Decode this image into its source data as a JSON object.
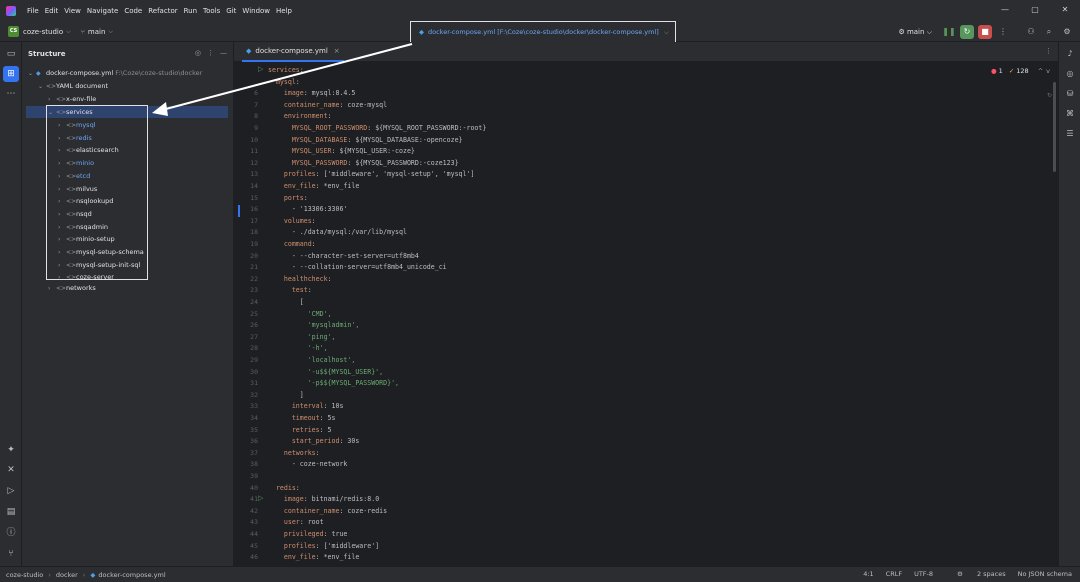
{
  "menu": [
    "File",
    "Edit",
    "View",
    "Navigate",
    "Code",
    "Refactor",
    "Run",
    "Tools",
    "Git",
    "Window",
    "Help"
  ],
  "window_controls": [
    "—",
    "▢",
    "✕"
  ],
  "toolbar": {
    "project_badge": "CS",
    "project_name": "coze-studio",
    "branch": "main",
    "run_config": "main",
    "chevron": "⌵"
  },
  "popup": {
    "file_name": "docker-compose.yml",
    "file_path": "[F:\\Coze\\coze-studio\\docker\\docker-compose.yml]",
    "chevron": "⌵"
  },
  "structure": {
    "title": "Structure",
    "root": {
      "label": "docker-compose.yml",
      "path": "F:\\Coze\\coze-studio\\docker"
    },
    "yaml_doc": "YAML document",
    "x_env": "x-env-file",
    "services": "services",
    "service_items": [
      "mysql",
      "redis",
      "elasticsearch",
      "minio",
      "etcd",
      "milvus",
      "nsqlookupd",
      "nsqd",
      "nsqadmin",
      "minio-setup",
      "mysql-setup-schema",
      "mysql-setup-init-sql",
      "coze-server"
    ],
    "networks": "networks"
  },
  "editor": {
    "tab_label": "docker-compose.yml",
    "tab_close": "×",
    "errors": "1",
    "warnings": "128",
    "lines": [
      {
        "n": "",
        "k": "services",
        "v": ":"
      },
      {
        "n": "",
        "k": "  mysql",
        "v": ":"
      },
      {
        "n": "6",
        "k": "    image",
        "v": ": mysql:8.4.5"
      },
      {
        "n": "7",
        "k": "    container_name",
        "v": ": coze-mysql"
      },
      {
        "n": "8",
        "k": "    environment",
        "v": ":"
      },
      {
        "n": "9",
        "k": "      MYSQL_ROOT_PASSWORD",
        "v": ": ${MYSQL_ROOT_PASSWORD:-root}"
      },
      {
        "n": "10",
        "k": "      MYSQL_DATABASE",
        "v": ": ${MYSQL_DATABASE:-opencoze}"
      },
      {
        "n": "11",
        "k": "      MYSQL_USER",
        "v": ": ${MYSQL_USER:-coze}"
      },
      {
        "n": "12",
        "k": "      MYSQL_PASSWORD",
        "v": ": ${MYSQL_PASSWORD:-coze123}"
      },
      {
        "n": "13",
        "k": "    profiles",
        "v": ": ['middleware', 'mysql-setup', 'mysql']"
      },
      {
        "n": "14",
        "k": "    env_file",
        "v": ": *env_file"
      },
      {
        "n": "15",
        "k": "    ports",
        "v": ":"
      },
      {
        "n": "16",
        "k": "",
        "v": "      - '13306:3306'"
      },
      {
        "n": "17",
        "k": "    volumes",
        "v": ":"
      },
      {
        "n": "18",
        "k": "",
        "v": "      - ./data/mysql:/var/lib/mysql"
      },
      {
        "n": "19",
        "k": "    command",
        "v": ":"
      },
      {
        "n": "20",
        "k": "",
        "v": "      - --character-set-server=utf8mb4"
      },
      {
        "n": "21",
        "k": "",
        "v": "      - --collation-server=utf8mb4_unicode_ci"
      },
      {
        "n": "22",
        "k": "    healthcheck",
        "v": ":"
      },
      {
        "n": "23",
        "k": "      test",
        "v": ":"
      },
      {
        "n": "24",
        "k": "",
        "v": "        ["
      },
      {
        "n": "25",
        "k": "",
        "v": "          'CMD',"
      },
      {
        "n": "26",
        "k": "",
        "v": "          'mysqladmin',"
      },
      {
        "n": "27",
        "k": "",
        "v": "          'ping',"
      },
      {
        "n": "28",
        "k": "",
        "v": "          '-h',"
      },
      {
        "n": "29",
        "k": "",
        "v": "          'localhost',"
      },
      {
        "n": "30",
        "k": "",
        "v": "          '-u$${MYSQL_USER}',"
      },
      {
        "n": "31",
        "k": "",
        "v": "          '-p$${MYSQL_PASSWORD}',"
      },
      {
        "n": "32",
        "k": "",
        "v": "        ]"
      },
      {
        "n": "33",
        "k": "      interval",
        "v": ": 10s"
      },
      {
        "n": "34",
        "k": "      timeout",
        "v": ": 5s"
      },
      {
        "n": "35",
        "k": "      retries",
        "v": ": 5"
      },
      {
        "n": "36",
        "k": "      start_period",
        "v": ": 30s"
      },
      {
        "n": "37",
        "k": "    networks",
        "v": ":"
      },
      {
        "n": "38",
        "k": "",
        "v": "      - coze-network"
      },
      {
        "n": "39",
        "k": "",
        "v": ""
      },
      {
        "n": "40",
        "k": "  redis",
        "v": ":"
      },
      {
        "n": "41",
        "k": "    image",
        "v": ": bitnami/redis:8.0"
      },
      {
        "n": "42",
        "k": "    container_name",
        "v": ": coze-redis"
      },
      {
        "n": "43",
        "k": "    user",
        "v": ": root"
      },
      {
        "n": "44",
        "k": "    privileged",
        "v": ": true"
      },
      {
        "n": "45",
        "k": "    profiles",
        "v": ": ['middleware']"
      },
      {
        "n": "46",
        "k": "    env_file",
        "v": ": *env_file"
      }
    ]
  },
  "statusbar": {
    "crumbs": [
      "coze-studio",
      "docker",
      "docker-compose.yml"
    ],
    "position": "4:1",
    "line_sep": "CRLF",
    "encoding": "UTF-8",
    "indent": "2 spaces",
    "schema": "No JSON schema"
  },
  "colors": {
    "accent": "#3574f0",
    "key": "#cf8e6d",
    "string": "#6aab73",
    "selection": "#2e436e"
  }
}
